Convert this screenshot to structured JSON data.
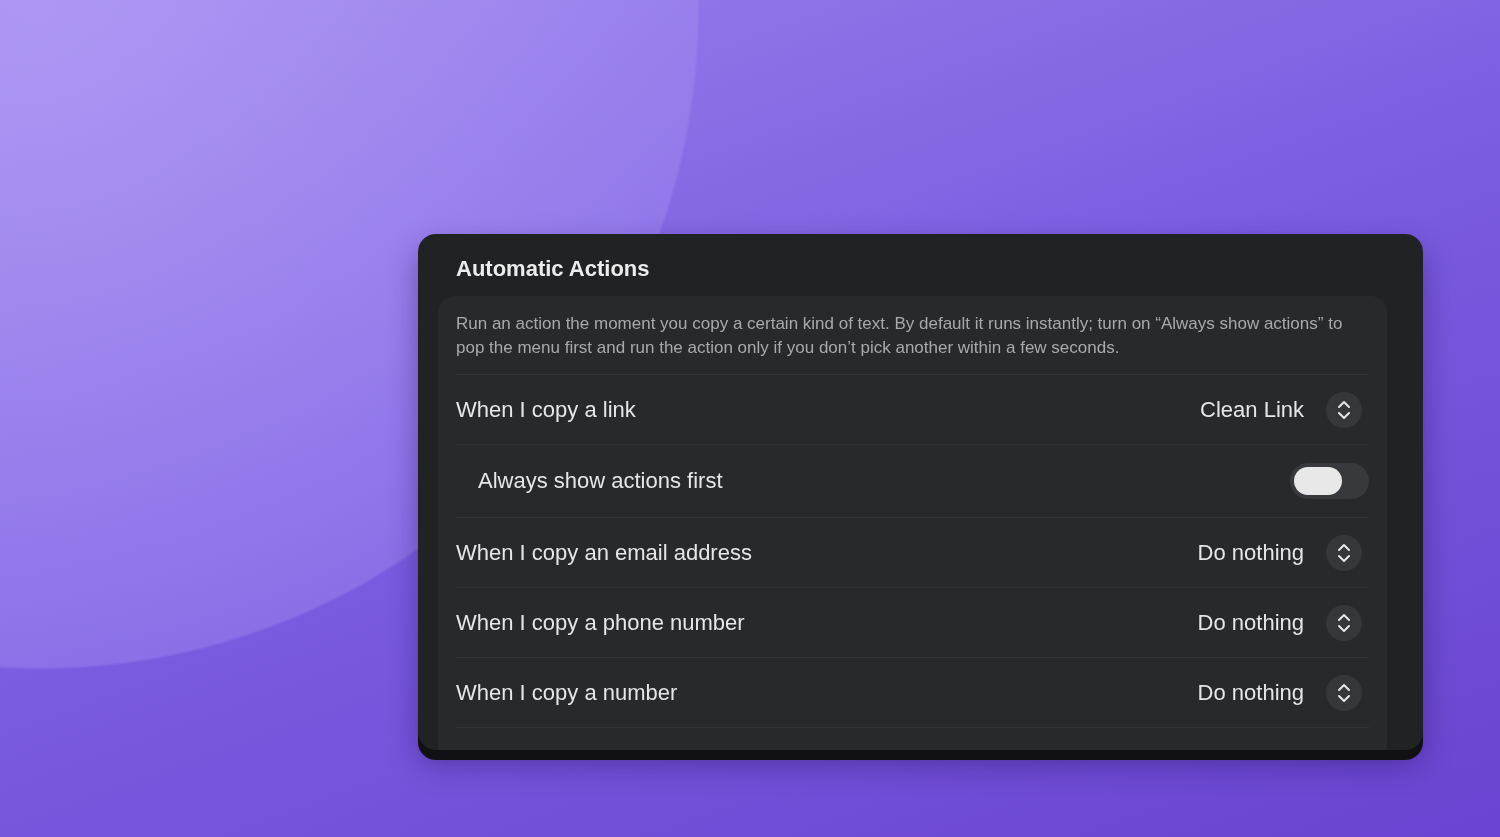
{
  "panel": {
    "title": "Automatic Actions",
    "description": "Run an action the moment you copy a certain kind of text. By default it runs instantly; turn on “Always show actions” to pop the menu first and run the action only if you don’t pick another within a few seconds.",
    "rows": [
      {
        "kind": "select",
        "label": "When I copy a link",
        "value": "Clean Link"
      },
      {
        "kind": "toggle",
        "label": "Always show actions first",
        "on": false
      },
      {
        "kind": "select",
        "label": "When I copy an email address",
        "value": "Do nothing"
      },
      {
        "kind": "select",
        "label": "When I copy a phone number",
        "value": "Do nothing"
      },
      {
        "kind": "select",
        "label": "When I copy a number",
        "value": "Do nothing"
      }
    ]
  }
}
